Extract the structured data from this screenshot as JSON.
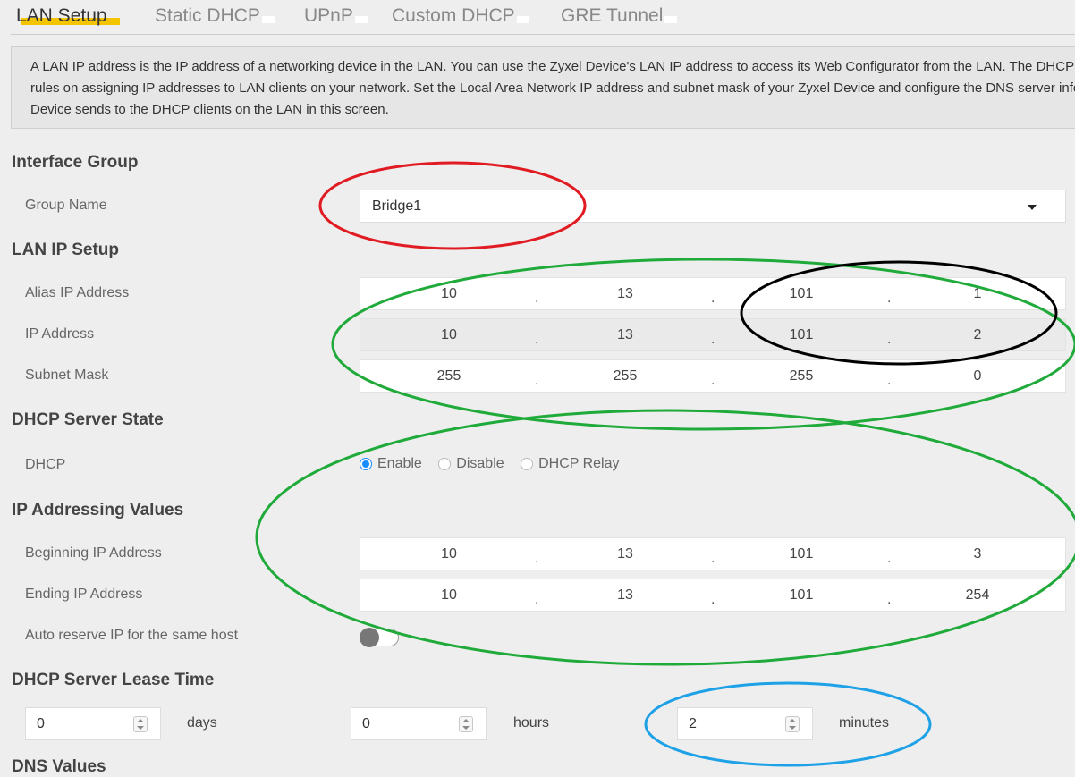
{
  "tabs": [
    "LAN Setup",
    "Static DHCP",
    "UPnP",
    "Custom DHCP",
    "GRE Tunnel"
  ],
  "info": [
    "A LAN IP address is the IP address of a networking device in the LAN. You can use the Zyxel Device's LAN IP address to access its Web Configurator from the LAN. The DHCP server sets",
    "rules on assigning IP addresses to LAN clients on your network. Set the Local Area Network IP address and subnet mask of your Zyxel Device and configure the DNS server information that the Zyxel",
    "Device sends to the DHCP clients on the LAN in this screen."
  ],
  "interface_group": {
    "title": "Interface Group",
    "group_name_label": "Group Name",
    "group_name_value": "Bridge1"
  },
  "lan_ip": {
    "title": "LAN IP Setup",
    "alias_label": "Alias IP Address",
    "alias": [
      "10",
      "13",
      "101",
      "1"
    ],
    "ip_label": "IP Address",
    "ip": [
      "10",
      "13",
      "101",
      "2"
    ],
    "mask_label": "Subnet Mask",
    "mask": [
      "255",
      "255",
      "255",
      "0"
    ]
  },
  "dhcp_state": {
    "title": "DHCP Server State",
    "label": "DHCP",
    "options": [
      "Enable",
      "Disable",
      "DHCP Relay"
    ],
    "selected": "Enable"
  },
  "ip_values": {
    "title": "IP Addressing Values",
    "begin_label": "Beginning IP Address",
    "begin": [
      "10",
      "13",
      "101",
      "3"
    ],
    "end_label": "Ending IP Address",
    "end": [
      "10",
      "13",
      "101",
      "254"
    ],
    "auto_reserve_label": "Auto reserve IP for the same host",
    "auto_reserve": false
  },
  "lease": {
    "title": "DHCP Server Lease Time",
    "days": "0",
    "days_label": "days",
    "hours": "0",
    "hours_label": "hours",
    "minutes": "2",
    "minutes_label": "minutes"
  },
  "dns_title": "DNS Values",
  "colors": {
    "accent": "#f5c400",
    "radio": "#1a8cff",
    "red_mark": "#e11b22",
    "green_mark": "#1faa3a",
    "black_mark": "#000000",
    "blue_mark": "#1ea1e6"
  }
}
